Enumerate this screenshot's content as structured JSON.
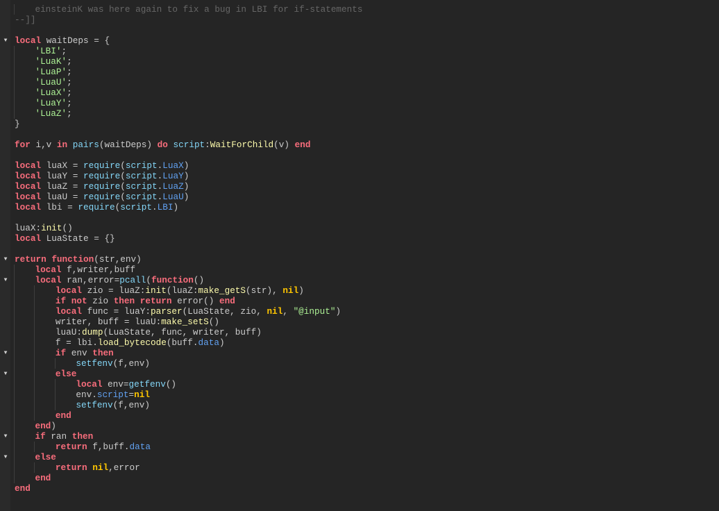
{
  "colors": {
    "keyword": "#f86d7c",
    "builtin": "#84d6f7",
    "property": "#61a1f1",
    "method": "#fdfbac",
    "string": "#adf195",
    "nil": "#ffc600",
    "comment": "#666666",
    "text": "#cccccc",
    "background": "#252525"
  },
  "fold_icon": "triangle-down-icon",
  "lines": [
    {
      "indent": 1,
      "tokens": [
        [
          "c",
          "einsteinK was here again to fix a bug in LBI for if-statements"
        ]
      ]
    },
    {
      "indent": 0,
      "tokens": [
        [
          "c",
          "--]]"
        ]
      ]
    },
    {
      "indent": 0,
      "tokens": []
    },
    {
      "indent": 0,
      "fold": true,
      "tokens": [
        [
          "k",
          "local"
        ],
        [
          "t",
          " waitDeps = {"
        ]
      ]
    },
    {
      "indent": 1,
      "tokens": [
        [
          "s",
          "'LBI'"
        ],
        [
          "t",
          ";"
        ]
      ]
    },
    {
      "indent": 1,
      "tokens": [
        [
          "s",
          "'LuaK'"
        ],
        [
          "t",
          ";"
        ]
      ]
    },
    {
      "indent": 1,
      "tokens": [
        [
          "s",
          "'LuaP'"
        ],
        [
          "t",
          ";"
        ]
      ]
    },
    {
      "indent": 1,
      "tokens": [
        [
          "s",
          "'LuaU'"
        ],
        [
          "t",
          ";"
        ]
      ]
    },
    {
      "indent": 1,
      "tokens": [
        [
          "s",
          "'LuaX'"
        ],
        [
          "t",
          ";"
        ]
      ]
    },
    {
      "indent": 1,
      "tokens": [
        [
          "s",
          "'LuaY'"
        ],
        [
          "t",
          ";"
        ]
      ]
    },
    {
      "indent": 1,
      "tokens": [
        [
          "s",
          "'LuaZ'"
        ],
        [
          "t",
          ";"
        ]
      ]
    },
    {
      "indent": 0,
      "tokens": [
        [
          "t",
          "}"
        ]
      ]
    },
    {
      "indent": 0,
      "tokens": []
    },
    {
      "indent": 0,
      "tokens": [
        [
          "k",
          "for"
        ],
        [
          "t",
          " i,v "
        ],
        [
          "k",
          "in"
        ],
        [
          "t",
          " "
        ],
        [
          "b",
          "pairs"
        ],
        [
          "t",
          "(waitDeps) "
        ],
        [
          "k",
          "do"
        ],
        [
          "t",
          " "
        ],
        [
          "b",
          "script"
        ],
        [
          "t",
          ":"
        ],
        [
          "m",
          "WaitForChild"
        ],
        [
          "t",
          "(v) "
        ],
        [
          "k",
          "end"
        ]
      ]
    },
    {
      "indent": 0,
      "tokens": []
    },
    {
      "indent": 0,
      "tokens": [
        [
          "k",
          "local"
        ],
        [
          "t",
          " luaX = "
        ],
        [
          "b",
          "require"
        ],
        [
          "t",
          "("
        ],
        [
          "b",
          "script"
        ],
        [
          "t",
          "."
        ],
        [
          "p",
          "LuaX"
        ],
        [
          "t",
          ")"
        ]
      ]
    },
    {
      "indent": 0,
      "tokens": [
        [
          "k",
          "local"
        ],
        [
          "t",
          " luaY = "
        ],
        [
          "b",
          "require"
        ],
        [
          "t",
          "("
        ],
        [
          "b",
          "script"
        ],
        [
          "t",
          "."
        ],
        [
          "p",
          "LuaY"
        ],
        [
          "t",
          ")"
        ]
      ]
    },
    {
      "indent": 0,
      "tokens": [
        [
          "k",
          "local"
        ],
        [
          "t",
          " luaZ = "
        ],
        [
          "b",
          "require"
        ],
        [
          "t",
          "("
        ],
        [
          "b",
          "script"
        ],
        [
          "t",
          "."
        ],
        [
          "p",
          "LuaZ"
        ],
        [
          "t",
          ")"
        ]
      ]
    },
    {
      "indent": 0,
      "tokens": [
        [
          "k",
          "local"
        ],
        [
          "t",
          " luaU = "
        ],
        [
          "b",
          "require"
        ],
        [
          "t",
          "("
        ],
        [
          "b",
          "script"
        ],
        [
          "t",
          "."
        ],
        [
          "p",
          "LuaU"
        ],
        [
          "t",
          ")"
        ]
      ]
    },
    {
      "indent": 0,
      "tokens": [
        [
          "k",
          "local"
        ],
        [
          "t",
          " lbi = "
        ],
        [
          "b",
          "require"
        ],
        [
          "t",
          "("
        ],
        [
          "b",
          "script"
        ],
        [
          "t",
          "."
        ],
        [
          "p",
          "LBI"
        ],
        [
          "t",
          ")"
        ]
      ]
    },
    {
      "indent": 0,
      "tokens": []
    },
    {
      "indent": 0,
      "tokens": [
        [
          "t",
          "luaX:"
        ],
        [
          "m",
          "init"
        ],
        [
          "t",
          "()"
        ]
      ]
    },
    {
      "indent": 0,
      "tokens": [
        [
          "k",
          "local"
        ],
        [
          "t",
          " LuaState = {}"
        ]
      ]
    },
    {
      "indent": 0,
      "tokens": []
    },
    {
      "indent": 0,
      "fold": true,
      "tokens": [
        [
          "k",
          "return"
        ],
        [
          "t",
          " "
        ],
        [
          "k",
          "function"
        ],
        [
          "t",
          "(str,env)"
        ]
      ]
    },
    {
      "indent": 1,
      "tokens": [
        [
          "k",
          "local"
        ],
        [
          "t",
          " f,writer,buff"
        ]
      ]
    },
    {
      "indent": 1,
      "fold": true,
      "tokens": [
        [
          "k",
          "local"
        ],
        [
          "t",
          " ran,error="
        ],
        [
          "b",
          "pcall"
        ],
        [
          "t",
          "("
        ],
        [
          "k",
          "function"
        ],
        [
          "t",
          "()"
        ]
      ]
    },
    {
      "indent": 2,
      "tokens": [
        [
          "k",
          "local"
        ],
        [
          "t",
          " zio = luaZ:"
        ],
        [
          "m",
          "init"
        ],
        [
          "t",
          "(luaZ:"
        ],
        [
          "m",
          "make_getS"
        ],
        [
          "t",
          "(str), "
        ],
        [
          "n",
          "nil"
        ],
        [
          "t",
          ")"
        ]
      ]
    },
    {
      "indent": 2,
      "tokens": [
        [
          "k",
          "if"
        ],
        [
          "t",
          " "
        ],
        [
          "k",
          "not"
        ],
        [
          "t",
          " zio "
        ],
        [
          "k",
          "then"
        ],
        [
          "t",
          " "
        ],
        [
          "k",
          "return"
        ],
        [
          "t",
          " error() "
        ],
        [
          "k",
          "end"
        ]
      ]
    },
    {
      "indent": 2,
      "tokens": [
        [
          "k",
          "local"
        ],
        [
          "t",
          " func = luaY:"
        ],
        [
          "m",
          "parser"
        ],
        [
          "t",
          "(LuaState, zio, "
        ],
        [
          "n",
          "nil"
        ],
        [
          "t",
          ", "
        ],
        [
          "s",
          "\"@input\""
        ],
        [
          "t",
          ")"
        ]
      ]
    },
    {
      "indent": 2,
      "tokens": [
        [
          "t",
          "writer, buff = luaU:"
        ],
        [
          "m",
          "make_setS"
        ],
        [
          "t",
          "()"
        ]
      ]
    },
    {
      "indent": 2,
      "tokens": [
        [
          "t",
          "luaU:"
        ],
        [
          "m",
          "dump"
        ],
        [
          "t",
          "(LuaState, func, writer, buff)"
        ]
      ]
    },
    {
      "indent": 2,
      "tokens": [
        [
          "t",
          "f = lbi."
        ],
        [
          "m",
          "load_bytecode"
        ],
        [
          "t",
          "(buff."
        ],
        [
          "p",
          "data"
        ],
        [
          "t",
          ")"
        ]
      ]
    },
    {
      "indent": 2,
      "fold": true,
      "tokens": [
        [
          "k",
          "if"
        ],
        [
          "t",
          " env "
        ],
        [
          "k",
          "then"
        ]
      ]
    },
    {
      "indent": 3,
      "tokens": [
        [
          "b",
          "setfenv"
        ],
        [
          "t",
          "(f,env)"
        ]
      ]
    },
    {
      "indent": 2,
      "fold": true,
      "tokens": [
        [
          "k",
          "else"
        ]
      ]
    },
    {
      "indent": 3,
      "tokens": [
        [
          "k",
          "local"
        ],
        [
          "t",
          " env="
        ],
        [
          "b",
          "getfenv"
        ],
        [
          "t",
          "()"
        ]
      ]
    },
    {
      "indent": 3,
      "tokens": [
        [
          "t",
          "env."
        ],
        [
          "p",
          "script"
        ],
        [
          "t",
          "="
        ],
        [
          "n",
          "nil"
        ]
      ]
    },
    {
      "indent": 3,
      "tokens": [
        [
          "b",
          "setfenv"
        ],
        [
          "t",
          "(f,env)"
        ]
      ]
    },
    {
      "indent": 2,
      "tokens": [
        [
          "k",
          "end"
        ]
      ]
    },
    {
      "indent": 1,
      "tokens": [
        [
          "k",
          "end"
        ],
        [
          "t",
          ")"
        ]
      ]
    },
    {
      "indent": 1,
      "fold": true,
      "tokens": [
        [
          "k",
          "if"
        ],
        [
          "t",
          " ran "
        ],
        [
          "k",
          "then"
        ]
      ]
    },
    {
      "indent": 2,
      "tokens": [
        [
          "k",
          "return"
        ],
        [
          "t",
          " f,buff."
        ],
        [
          "p",
          "data"
        ]
      ]
    },
    {
      "indent": 1,
      "fold": true,
      "tokens": [
        [
          "k",
          "else"
        ]
      ]
    },
    {
      "indent": 2,
      "tokens": [
        [
          "k",
          "return"
        ],
        [
          "t",
          " "
        ],
        [
          "n",
          "nil"
        ],
        [
          "t",
          ",error"
        ]
      ]
    },
    {
      "indent": 1,
      "tokens": [
        [
          "k",
          "end"
        ]
      ]
    },
    {
      "indent": 0,
      "tokens": [
        [
          "k",
          "end"
        ]
      ]
    }
  ]
}
